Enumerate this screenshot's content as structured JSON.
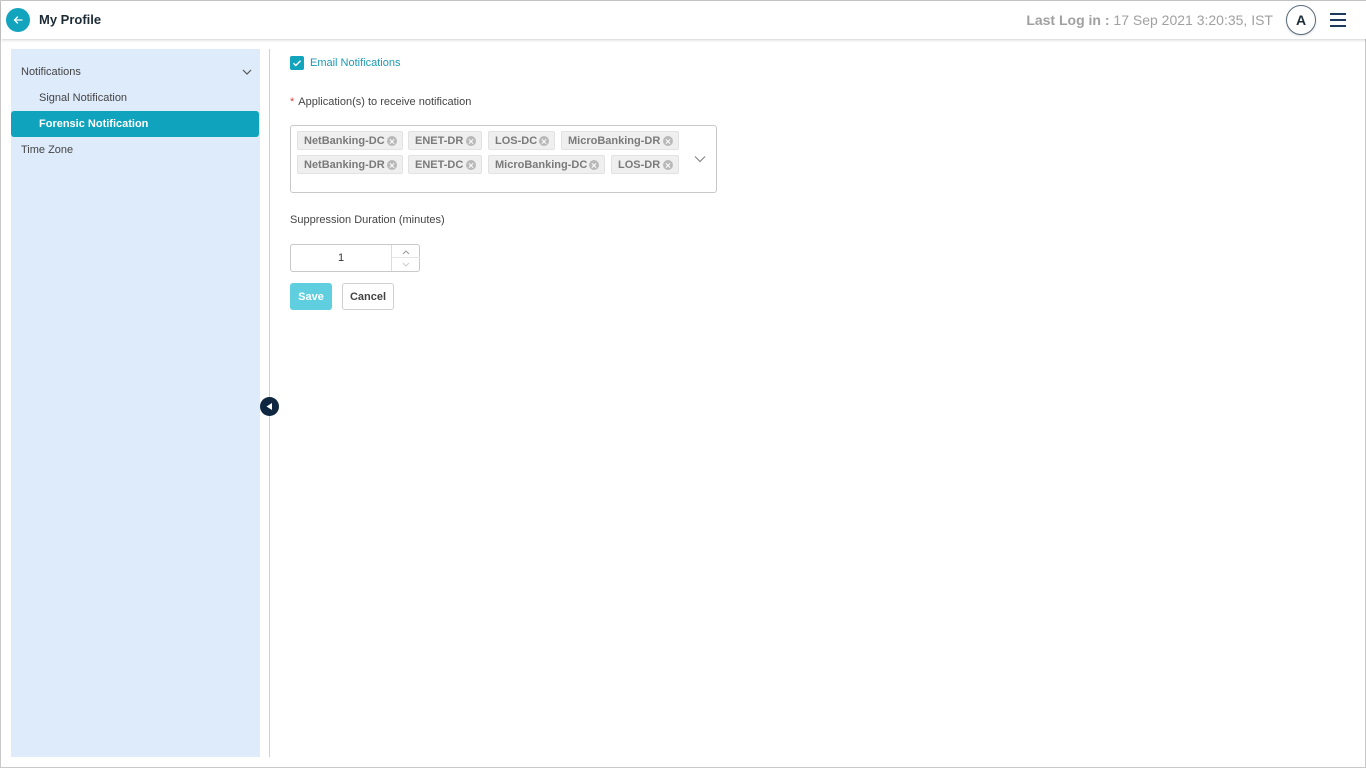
{
  "header": {
    "title": "My Profile",
    "last_login_label": "Last Log in :",
    "last_login_value": "17 Sep 2021 3:20:35, IST",
    "avatar_initial": "A",
    "back_icon": "arrow-left-icon",
    "menu_icon": "hamburger-icon"
  },
  "sidebar": {
    "group_label": "Notifications",
    "items": [
      {
        "label": "Signal Notification",
        "active": false
      },
      {
        "label": "Forensic Notification",
        "active": true
      }
    ],
    "timezone_label": "Time Zone"
  },
  "form": {
    "email_notifications_label": "Email Notifications",
    "email_notifications_checked": true,
    "required_mark": "*",
    "applications_label": "Application(s) to receive notification",
    "applications": [
      "NetBanking-DC",
      "ENET-DR",
      "LOS-DC",
      "MicroBanking-DR",
      "NetBanking-DR",
      "ENET-DC",
      "MicroBanking-DC",
      "LOS-DR"
    ],
    "suppression_label": "Suppression Duration (minutes)",
    "suppression_value": "1",
    "save_label": "Save",
    "cancel_label": "Cancel"
  },
  "colors": {
    "accent": "#12a3bd",
    "sidebar_bg": "#deebfb",
    "save_disabled": "#5fcfe0"
  }
}
